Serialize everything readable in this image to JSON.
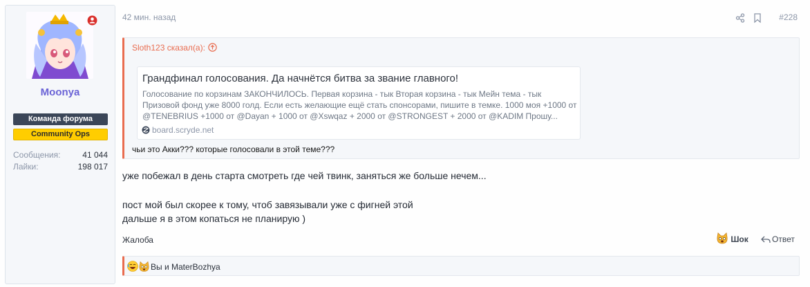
{
  "user": {
    "name": "Moonya",
    "banners": [
      "Команда форума",
      "Community Ops"
    ],
    "stats": [
      {
        "label": "Сообщения:",
        "value": "41 044"
      },
      {
        "label": "Лайки:",
        "value": "198 017"
      }
    ]
  },
  "post": {
    "time": "42 мин. назад",
    "number": "#228",
    "quote": {
      "author_line": "Sloth123 сказал(а):",
      "embed": {
        "title": "Грандфинал голосования. Да начнётся битва за звание главного!",
        "description": "Голосование по корзинам ЗАКОНЧИЛОСЬ. Первая корзина - тык Вторая корзина - тык Мейн тема - тык Призовой фонд уже 8000 голд. Если есть желающие ещё стать спонсорами, пишите в темке. 1000 моя +1000 от @TENEBRIUS +1000 от @Dayan + 1000 от @Xswqaz + 2000 от @STRONGEST + 2000 от @KADIM Прошу...",
        "source": "board.scryde.net"
      },
      "text": "чьи это Акки??? которые голосовали в этой теме???"
    },
    "lines": [
      "уже побежал в день старта смотреть где чей твинк, заняться же больше нечем...",
      "пост мой был скорее к тому, чтоб завязывали уже с фигней этой",
      "дальше я в этом копаться не планирую )"
    ],
    "report_label": "Жалоба",
    "reaction_label": "Шок",
    "reply_label": "Ответ",
    "reactions_text": "Вы и MaterBozhya"
  },
  "colors": {
    "accent": "#e96c4f",
    "username": "#6a63d6",
    "banner_team": "#3b4658",
    "banner_ops": "#ffcd00"
  }
}
